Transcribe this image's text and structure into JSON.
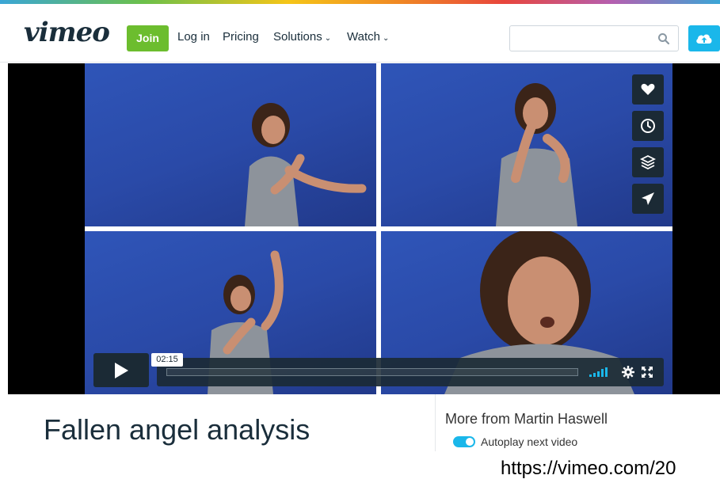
{
  "header": {
    "logo": "vimeo",
    "join_label": "Join",
    "nav": [
      {
        "label": "Log in"
      },
      {
        "label": "Pricing"
      },
      {
        "label": "Solutions",
        "dropdown": true
      },
      {
        "label": "Watch",
        "dropdown": true
      }
    ],
    "search": {
      "placeholder": "",
      "value": ""
    },
    "upload_icon": "upload-cloud-icon"
  },
  "player": {
    "side_buttons": [
      "heart-icon",
      "clock-icon",
      "layers-icon",
      "send-icon"
    ],
    "current_time": "02:15",
    "controls": [
      "play-icon",
      "volume-icon",
      "gear-icon",
      "fullscreen-icon"
    ]
  },
  "video_info": {
    "title": "Fallen angel analysis",
    "more_from": "More from Martin Haswell",
    "autoplay_label": "Autoplay next video",
    "autoplay_on": true
  },
  "footer": {
    "url": "https://vimeo.com/20"
  },
  "colors": {
    "join_green": "#6cbd2e",
    "upload_blue": "#1ab7ea",
    "control_dark": "#1b2a35",
    "video_blue": "#2a4aa8"
  }
}
